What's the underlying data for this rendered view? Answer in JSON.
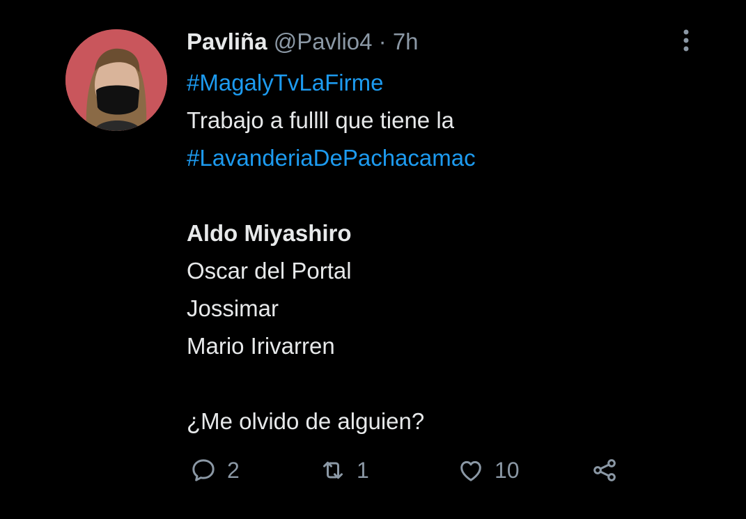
{
  "tweet": {
    "author_name": "Pavliña",
    "handle": "@Pavlio4",
    "separator": "·",
    "time": "7h",
    "lines": {
      "l1": "#MagalyTvLaFirme",
      "l2": "Trabajo a fullll que tiene la",
      "l3": "#LavanderiaDePachacamac",
      "l5": "Aldo Miyashiro",
      "l6": "Oscar del Portal",
      "l7": "Jossimar",
      "l8": "Mario Irivarren",
      "l10": "¿Me olvido de alguien?"
    }
  },
  "actions": {
    "reply_count": "2",
    "retweet_count": "1",
    "like_count": "10"
  },
  "icons": {
    "reply": "reply-icon",
    "retweet": "retweet-icon",
    "like": "heart-icon",
    "share": "share-icon",
    "more": "more-vertical-icon"
  },
  "colors": {
    "background": "#000000",
    "text": "#e7e9ea",
    "muted": "#8b98a5",
    "link": "#1d9bf0"
  }
}
